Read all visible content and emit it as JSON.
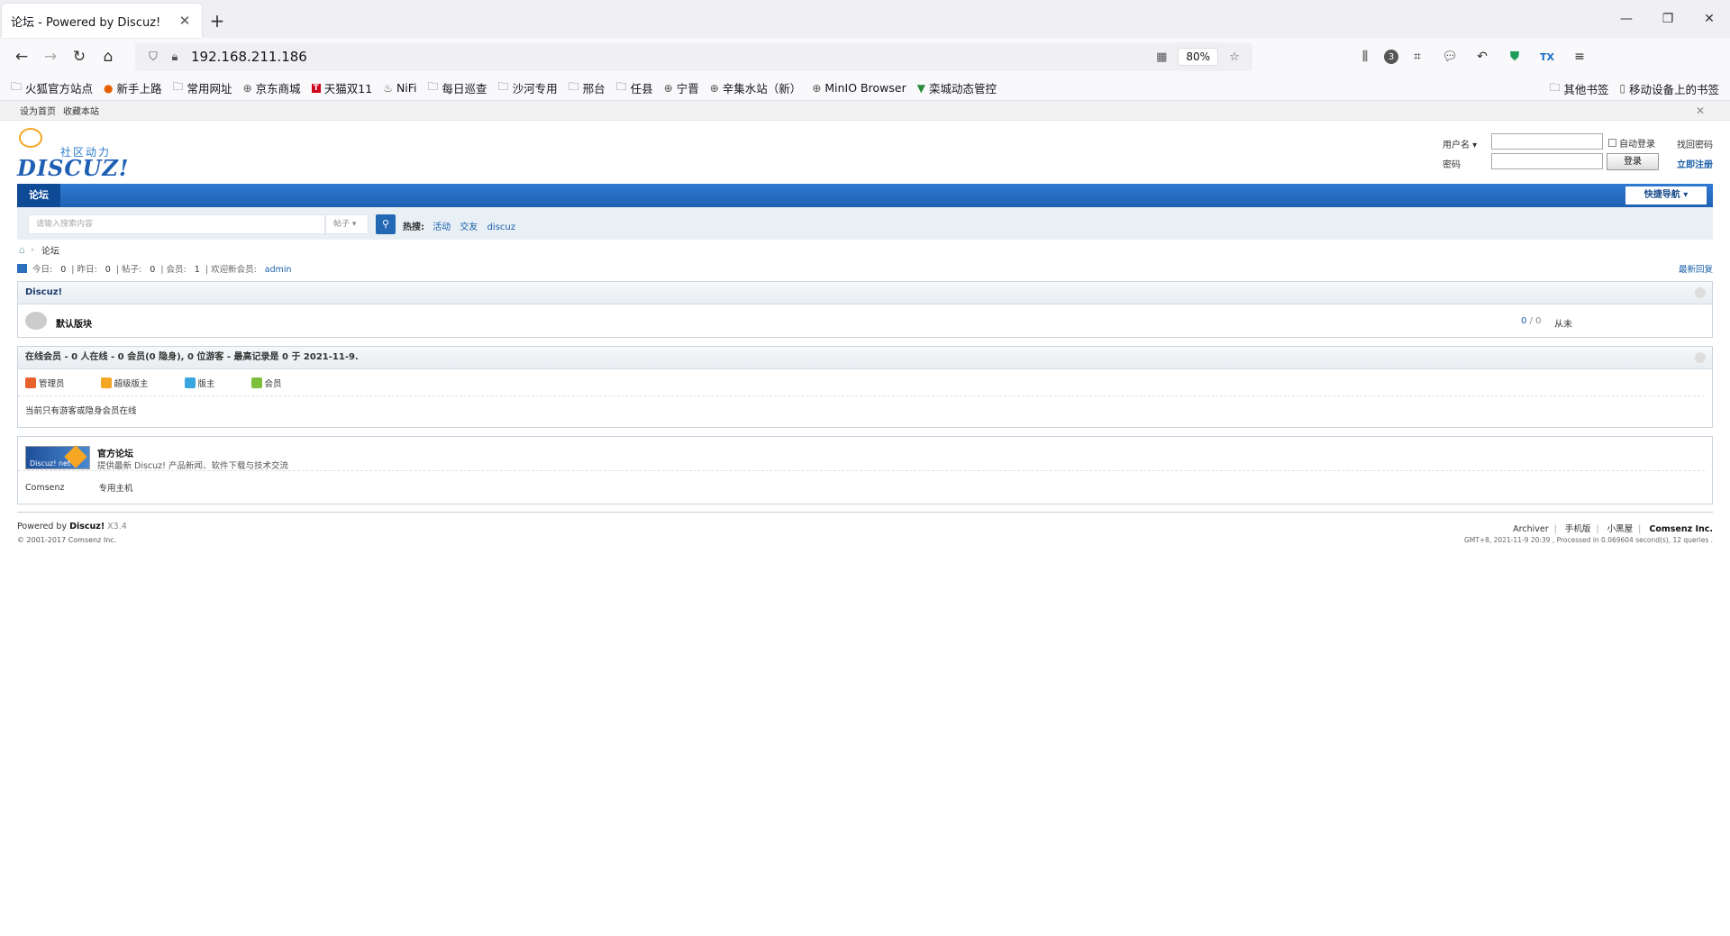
{
  "browser": {
    "tab_title": "论坛 - Powered by Discuz!",
    "url": "192.168.211.186",
    "zoom": "80%",
    "badge_count": "3",
    "bookmarks": [
      {
        "icon": "folder-icon",
        "label": "火狐官方站点"
      },
      {
        "icon": "firefox-icon",
        "label": "新手上路"
      },
      {
        "icon": "folder-icon",
        "label": "常用网址"
      },
      {
        "icon": "globe-icon",
        "label": "京东商城"
      },
      {
        "icon": "tmall-icon",
        "label": "天猫双11"
      },
      {
        "icon": "nifi-icon",
        "label": "NiFi"
      },
      {
        "icon": "folder-icon",
        "label": "每日巡查"
      },
      {
        "icon": "folder-icon",
        "label": "沙河专用"
      },
      {
        "icon": "folder-icon",
        "label": "邢台"
      },
      {
        "icon": "folder-icon",
        "label": "任县"
      },
      {
        "icon": "globe-icon",
        "label": "宁晋"
      },
      {
        "icon": "globe-icon",
        "label": "辛集水站（新）"
      },
      {
        "icon": "globe-icon",
        "label": "MinIO Browser"
      },
      {
        "icon": "vue-icon",
        "label": "栾城动态管控"
      }
    ],
    "other_bookmarks": "其他书签",
    "mobile_bookmarks": "移动设备上的书签"
  },
  "site": {
    "top_links": [
      "设为首页",
      "收藏本站"
    ],
    "logo_tagline": "社区动力",
    "logo_name": "DISCUZ!",
    "login": {
      "username_label": "用户名",
      "password_label": "密码",
      "auto_login": "自动登录",
      "forgot": "找回密码",
      "register": "立即注册",
      "submit": "登录"
    },
    "nav_current": "论坛",
    "quick_nav": "快捷导航",
    "search_placeholder": "请输入搜索内容",
    "search_type": "帖子",
    "hot_label": "热搜:",
    "hot_items": [
      "活动",
      "交友",
      "discuz"
    ],
    "breadcrumb": "论坛",
    "stats": {
      "today_label": "今日:",
      "today": "0",
      "yesterday_label": "昨日:",
      "yesterday": "0",
      "posts_label": "帖子:",
      "posts": "0",
      "members_label": "会员:",
      "members": "1",
      "newest_label": "欢迎新会员:",
      "newest": "admin",
      "latest_replies": "最新回复"
    },
    "category_title": "Discuz!",
    "forum": {
      "name": "默认版块",
      "threads": "0",
      "posts": "0",
      "last": "从未"
    },
    "online_title": "在线会员 - 0 人在线 - 0 会员(0 隐身), 0 位游客 - 最高记录是 0 于 2021-11-9.",
    "legend": [
      {
        "label": "管理员",
        "color": "#e8602c"
      },
      {
        "label": "超级版主",
        "color": "#f5a623"
      },
      {
        "label": "版主",
        "color": "#3aa6e0"
      },
      {
        "label": "会员",
        "color": "#7cbf3a"
      }
    ],
    "online_text": "当前只有游客或隐身会员在线",
    "link_logo_text": "Discuz! net",
    "link_name": "官方论坛",
    "link_desc": "提供最新 Discuz! 产品新闻、软件下载与技术交流",
    "text_links": [
      "Comsenz",
      "专用主机"
    ],
    "footer": {
      "powered_prefix": "Powered by ",
      "powered_brand": "Discuz!",
      "version": " X3.4",
      "copyright": "© 2001-2017 Comsenz Inc.",
      "links": [
        "Archiver",
        "手机版",
        "小黑屋"
      ],
      "company": "Comsenz Inc.",
      "gmt": "GMT+8, 2021-11-9 20:39 , Processed in 0.069604 second(s), 12 queries ."
    }
  }
}
